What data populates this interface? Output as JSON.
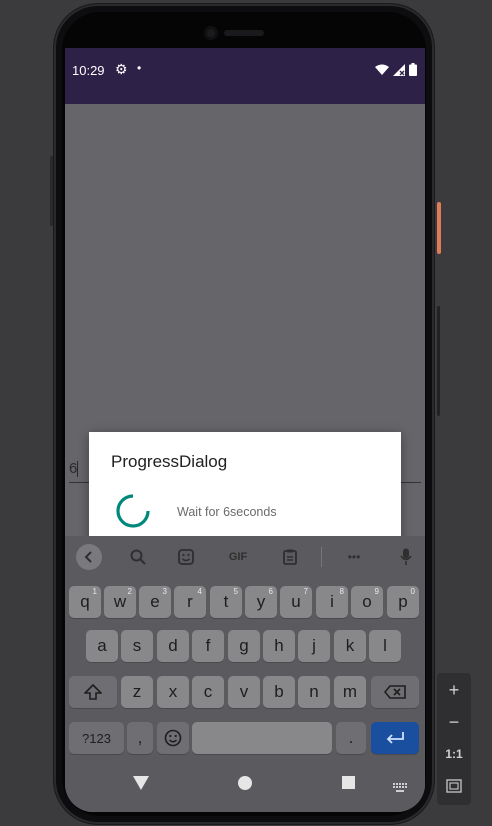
{
  "status_bar": {
    "time": "10:29"
  },
  "dialog": {
    "title": "ProgressDialog",
    "message": "Wait for 6seconds"
  },
  "edit_text": {
    "value": "6"
  },
  "keyboard": {
    "toolbar_gif": "GIF",
    "toolbar_more": "•••",
    "row1": [
      {
        "key": "q",
        "hint": "1"
      },
      {
        "key": "w",
        "hint": "2"
      },
      {
        "key": "e",
        "hint": "3"
      },
      {
        "key": "r",
        "hint": "4"
      },
      {
        "key": "t",
        "hint": "5"
      },
      {
        "key": "y",
        "hint": "6"
      },
      {
        "key": "u",
        "hint": "7"
      },
      {
        "key": "i",
        "hint": "8"
      },
      {
        "key": "o",
        "hint": "9"
      },
      {
        "key": "p",
        "hint": "0"
      }
    ],
    "row2": [
      "a",
      "s",
      "d",
      "f",
      "g",
      "h",
      "j",
      "k",
      "l"
    ],
    "row3": [
      "z",
      "x",
      "c",
      "v",
      "b",
      "n",
      "m"
    ],
    "symbols_label": "?123",
    "comma_label": ",",
    "period_label": "."
  },
  "zoom_panel": {
    "plus": "+",
    "minus": "−",
    "ratio": "1:1"
  },
  "colors": {
    "status_bar": "#2e2148",
    "app_bg": "#666569",
    "spinner": "#00897b",
    "enter_key": "#1a4fa0"
  }
}
